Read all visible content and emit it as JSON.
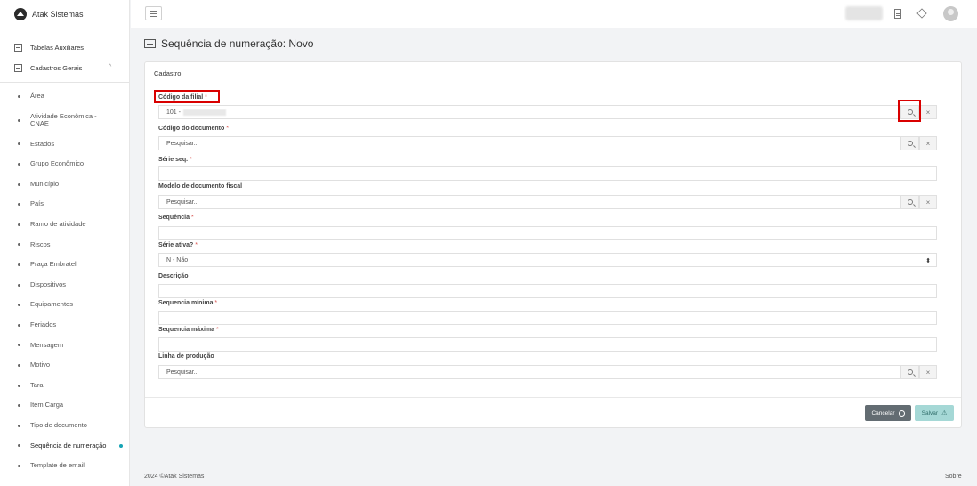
{
  "brand": {
    "name": "Atak Sistemas"
  },
  "sidebar": {
    "sections": [
      {
        "label": "Tabelas Auxiliares"
      },
      {
        "label": "Cadastros Gerais",
        "chevron": "^"
      }
    ],
    "items": [
      {
        "label": "Área"
      },
      {
        "label": "Atividade Econômica - CNAE"
      },
      {
        "label": "Estados"
      },
      {
        "label": "Grupo Econômico"
      },
      {
        "label": "Município"
      },
      {
        "label": "País"
      },
      {
        "label": "Ramo de atividade"
      },
      {
        "label": "Riscos"
      },
      {
        "label": "Praça Embratel"
      },
      {
        "label": "Dispositivos"
      },
      {
        "label": "Equipamentos"
      },
      {
        "label": "Feriados"
      },
      {
        "label": "Mensagem"
      },
      {
        "label": "Motivo"
      },
      {
        "label": "Tara"
      },
      {
        "label": "Item Carga"
      },
      {
        "label": "Tipo de documento"
      },
      {
        "label": "Sequência de numeração"
      },
      {
        "label": "Template de email"
      }
    ]
  },
  "page": {
    "title": "Sequência de numeração: Novo"
  },
  "card": {
    "header": "Cadastro"
  },
  "form": {
    "required_mark": "*",
    "codigo_filial": {
      "label": "Código da filial",
      "value": "101 -"
    },
    "codigo_documento": {
      "label": "Código do documento",
      "placeholder": "Pesquisar..."
    },
    "serie_seq": {
      "label": "Série seq."
    },
    "modelo_documento": {
      "label": "Modelo de documento fiscal",
      "placeholder": "Pesquisar..."
    },
    "sequencia": {
      "label": "Sequência"
    },
    "serie_ativa": {
      "label": "Série ativa?",
      "value": "N - Não",
      "arrow": "⬍"
    },
    "descricao": {
      "label": "Descrição"
    },
    "sequencia_minima": {
      "label": "Sequencia mínima"
    },
    "sequencia_maxima": {
      "label": "Sequencia máxima"
    },
    "linha_producao": {
      "label": "Linha de produção",
      "placeholder": "Pesquisar..."
    },
    "clear_glyph": "×"
  },
  "actions": {
    "cancel": "Cancelar",
    "save": "Salvar",
    "save_icon": "⚠"
  },
  "footer": {
    "copyright": "2024 ©Atak Sistemas",
    "about": "Sobre"
  },
  "colors": {
    "accent": "#16a4b5",
    "highlight": "#d90000",
    "cancel_bg": "#636c72",
    "save_bg": "#a5d8d6"
  }
}
